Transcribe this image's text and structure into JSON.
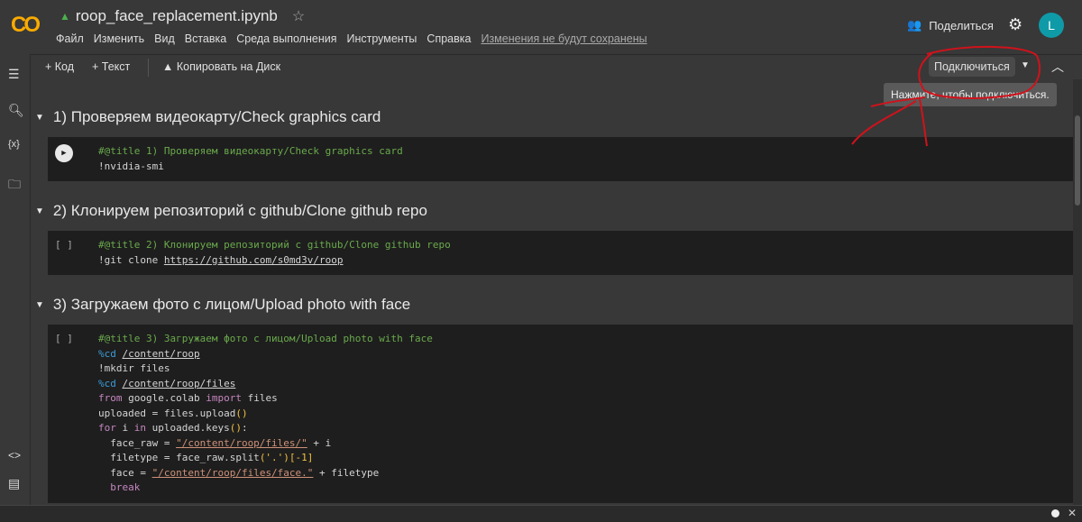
{
  "header": {
    "logo": "CO",
    "title": "roop_face_replacement.ipynb",
    "menu": [
      "Файл",
      "Изменить",
      "Вид",
      "Вставка",
      "Среда выполнения",
      "Инструменты",
      "Справка"
    ],
    "unsaved": "Изменения не будут сохранены",
    "share": "Поделиться",
    "avatar": "L"
  },
  "toolbar": {
    "add_code": "+ Код",
    "add_text": "+ Текст",
    "copy_drive": "Копировать на Диск",
    "connect": "Подключиться",
    "tooltip": "Нажмите, чтобы подключиться."
  },
  "cells": [
    {
      "heading": "1) Проверяем видеокарту/Check graphics card",
      "gutter": "run",
      "lines": [
        [
          {
            "t": "#@title 1) Проверяем видеокарту/Check graphics card",
            "c": "cm"
          }
        ],
        [
          {
            "t": "!nvidia-smi",
            "c": "pl"
          }
        ]
      ]
    },
    {
      "heading": "2) Клонируем репозиторий с github/Clone github repo",
      "gutter": "[ ]",
      "lines": [
        [
          {
            "t": "#@title 2) Клонируем репозиторий с github/Clone github repo",
            "c": "cm"
          }
        ],
        [
          {
            "t": "!git clone ",
            "c": "pl"
          },
          {
            "t": "https://github.com/s0md3v/roop",
            "c": "pl u"
          }
        ]
      ]
    },
    {
      "heading": "3) Загружаем фото с лицом/Upload photo with face",
      "gutter": "[ ]",
      "lines": [
        [
          {
            "t": "#@title 3) Загружаем фото с лицом/Upload photo with face",
            "c": "cm"
          }
        ],
        [
          {
            "t": "%cd ",
            "c": "mg"
          },
          {
            "t": "/content/roop",
            "c": "pl u"
          }
        ],
        [
          {
            "t": "!mkdir files",
            "c": "pl"
          }
        ],
        [
          {
            "t": "%cd ",
            "c": "mg"
          },
          {
            "t": "/content/roop/files",
            "c": "pl u"
          }
        ],
        [
          {
            "t": "from",
            "c": "kw"
          },
          {
            "t": " google.colab ",
            "c": "pl"
          },
          {
            "t": "import",
            "c": "kw"
          },
          {
            "t": " files",
            "c": "pl"
          }
        ],
        [
          {
            "t": "uploaded = files.upload",
            "c": "pl"
          },
          {
            "t": "()",
            "c": "yl"
          }
        ],
        [
          {
            "t": "for",
            "c": "kw"
          },
          {
            "t": " i ",
            "c": "pl"
          },
          {
            "t": "in",
            "c": "kw"
          },
          {
            "t": " uploaded.keys",
            "c": "pl"
          },
          {
            "t": "()",
            "c": "yl"
          },
          {
            "t": ":",
            "c": "pl"
          }
        ],
        [
          {
            "t": "  face_raw = ",
            "c": "pl"
          },
          {
            "t": "\"/content/roop/files/\"",
            "c": "st u"
          },
          {
            "t": " + i",
            "c": "pl"
          }
        ],
        [
          {
            "t": "  filetype = face_raw.split",
            "c": "pl"
          },
          {
            "t": "('.')",
            "c": "yl"
          },
          {
            "t": "[-1]",
            "c": "yl"
          }
        ],
        [
          {
            "t": "  face = ",
            "c": "pl"
          },
          {
            "t": "\"/content/roop/files/face.\"",
            "c": "st u"
          },
          {
            "t": " + filetype",
            "c": "pl"
          }
        ],
        [
          {
            "t": "  break",
            "c": "kw"
          }
        ]
      ]
    }
  ],
  "colors": {
    "annotation": "#d0121b",
    "logo": "#f9ab00",
    "avatar": "#0f9aa8"
  }
}
